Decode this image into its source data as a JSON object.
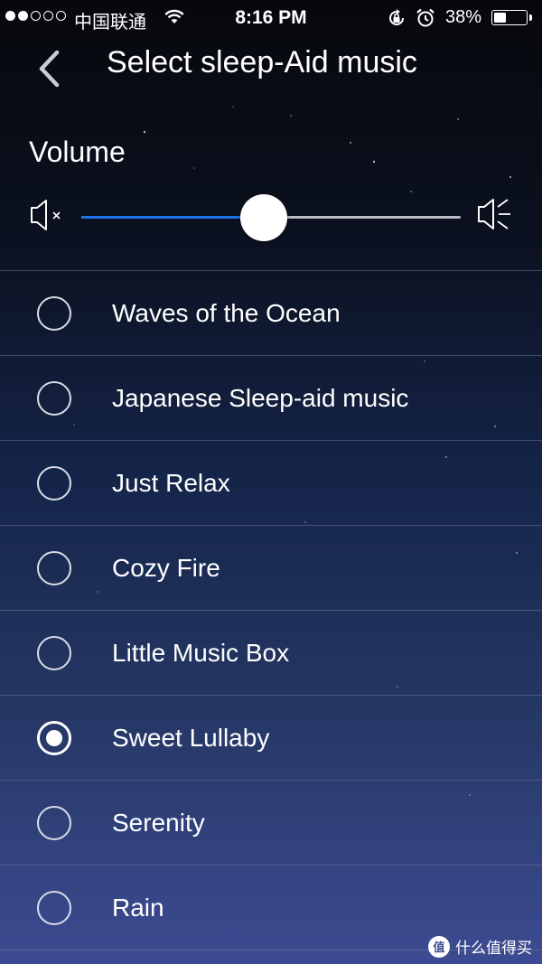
{
  "status_bar": {
    "carrier": "中国联通",
    "time": "8:16 PM",
    "battery_percent_text": "38%",
    "battery_level": 0.38,
    "signal_strength": 2,
    "signal_max": 5
  },
  "nav": {
    "title": "Select sleep-Aid music",
    "back_icon": "chevron-left-icon"
  },
  "volume": {
    "label": "Volume",
    "level": 0.48,
    "min_icon": "speaker-mute-icon",
    "max_icon": "speaker-loud-icon",
    "accent_color": "#1a73e6"
  },
  "music_list": {
    "items": [
      {
        "label": "Waves of the Ocean",
        "selected": false
      },
      {
        "label": "Japanese Sleep-aid music",
        "selected": false
      },
      {
        "label": "Just Relax",
        "selected": false
      },
      {
        "label": "Cozy Fire",
        "selected": false
      },
      {
        "label": "Little Music Box",
        "selected": false
      },
      {
        "label": "Sweet Lullaby",
        "selected": true
      },
      {
        "label": "Serenity",
        "selected": false
      },
      {
        "label": "Rain",
        "selected": false
      }
    ]
  },
  "watermark": {
    "logo_text": "值",
    "text": "什么值得买"
  }
}
